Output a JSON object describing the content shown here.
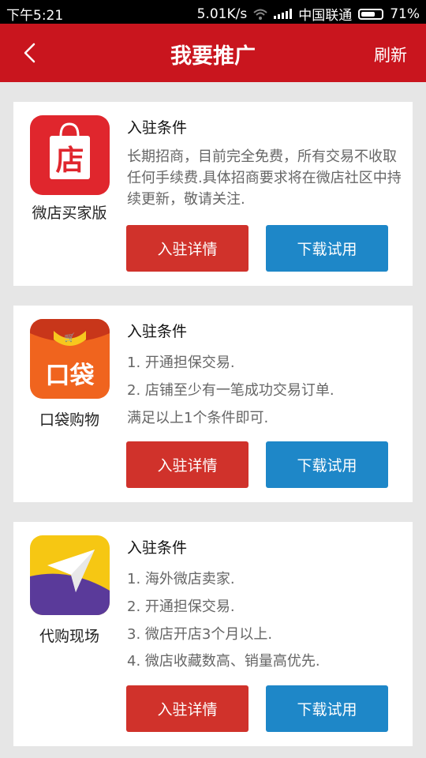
{
  "status_bar": {
    "time": "下午5:21",
    "net_speed": "5.01K/s",
    "carrier": "中国联通",
    "battery": "71%",
    "battery_level": 0.71
  },
  "header": {
    "title": "我要推广",
    "refresh_label": "刷新"
  },
  "colors": {
    "header_red": "#c9151e",
    "detail_button": "#d0322b",
    "download_button": "#1e87c8"
  },
  "apps": [
    {
      "name": "微店买家版",
      "icon_text": "店",
      "condition_title": "入驻条件",
      "description": "长期招商，目前完全免费，所有交易不收取任何手续费.具体招商要求将在微店社区中持续更新，敬请关注.",
      "detail_button": "入驻详情",
      "download_button": "下载试用"
    },
    {
      "name": "口袋购物",
      "icon_text": "口袋",
      "condition_title": "入驻条件",
      "conditions": [
        "1. 开通担保交易.",
        "2. 店铺至少有一笔成功交易订单.",
        "满足以上1个条件即可."
      ],
      "detail_button": "入驻详情",
      "download_button": "下载试用"
    },
    {
      "name": "代购现场",
      "condition_title": "入驻条件",
      "conditions": [
        "1. 海外微店卖家.",
        "2. 开通担保交易.",
        "3. 微店开店3个月以上.",
        "4. 微店收藏数高、销量高优先."
      ],
      "detail_button": "入驻详情",
      "download_button": "下载试用"
    }
  ]
}
